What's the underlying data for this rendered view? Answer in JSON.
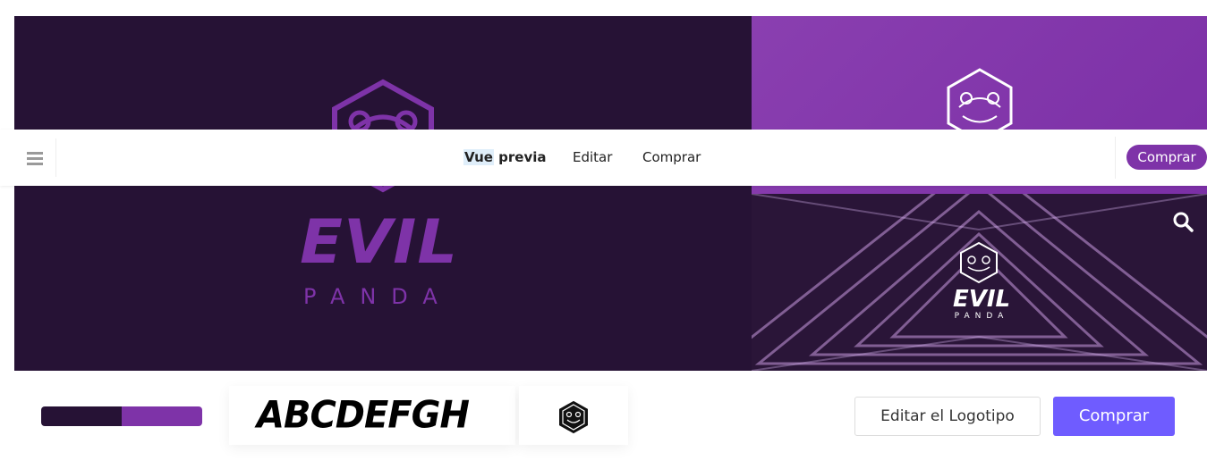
{
  "hero": {
    "logo_main": "EVIL",
    "logo_sub": "PANDA",
    "search_icon": "search-icon"
  },
  "colors": {
    "dark_purple": "#261235",
    "brand_purple": "#7e33a8",
    "accent_blue": "#6f5cff"
  },
  "toolbar": {
    "menu_icon": "hamburger-icon",
    "tabs": [
      {
        "label_a": "Vue",
        "label_b": " previa",
        "active": true
      },
      {
        "label": "Editar"
      },
      {
        "label": "Comprar"
      }
    ],
    "buy_label": "Comprar"
  },
  "bottom": {
    "palette": [
      "#261235",
      "#7e33a8"
    ],
    "font_sample": "ABCDEFGH",
    "edit_logo_label": "Editar el Logotipo",
    "buy_label": "Comprar"
  }
}
